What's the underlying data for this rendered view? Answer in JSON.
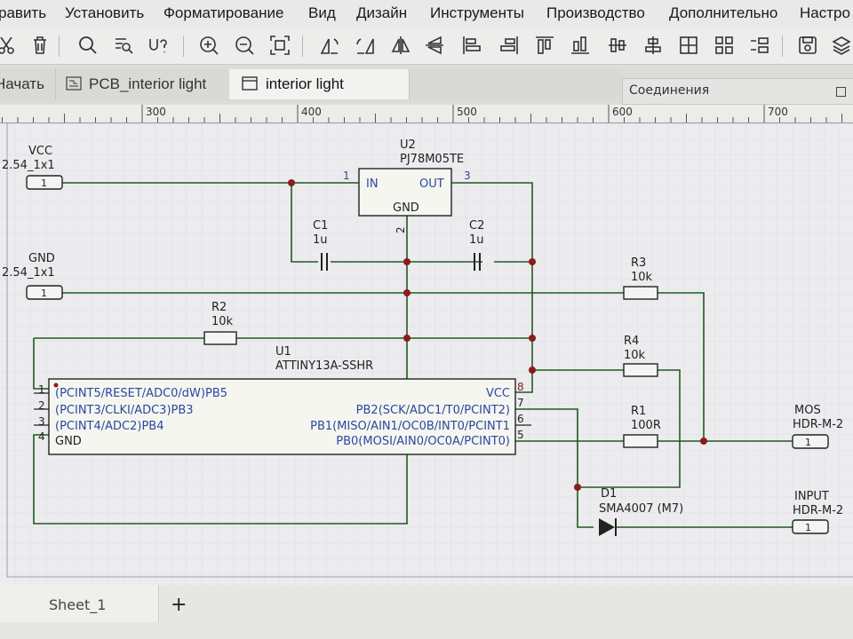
{
  "menu": {
    "items": [
      "равить",
      "Установить",
      "Форматирование",
      "Вид",
      "Дизайн",
      "Инструменты",
      "Производство",
      "Дополнительно",
      "Настро"
    ]
  },
  "tabs": [
    {
      "label": "Начать",
      "icon": "none"
    },
    {
      "label": "PCB_interior light",
      "icon": "pcb-icon"
    },
    {
      "label": "interior light",
      "icon": "schematic-icon",
      "active": true
    }
  ],
  "panel": {
    "title": "Соединения"
  },
  "ruler": {
    "labels": [
      "300",
      "400",
      "500",
      "600",
      "700"
    ]
  },
  "sheets": {
    "tabs": [
      "Sheet_1"
    ],
    "add_label": "+"
  },
  "colors": {
    "wire": "#1e5a1e",
    "junction": "#8a1c1c",
    "pin_number": "#8a1c1c",
    "pin_name": "#2848a0",
    "grid": "#c9ccd6",
    "canvas": "#ecebee"
  },
  "schematic": {
    "connectors": {
      "vcc": {
        "name": "VCC",
        "package": "2.54_1x1",
        "pin": "1"
      },
      "gnd": {
        "name": "GND",
        "package": "2.54_1x1",
        "pin": "1"
      },
      "mos": {
        "name": "MOS",
        "package": "HDR-M-2",
        "pin": "1"
      },
      "input": {
        "name": "INPUT",
        "package": "HDR-M-2",
        "pin": "1"
      }
    },
    "u2": {
      "ref": "U2",
      "value": "PJ78M05TE",
      "pin_in_name": "IN",
      "pin_out_name": "OUT",
      "pin_gnd_name": "GND",
      "pin_in_num": "1",
      "pin_out_num": "3",
      "pin_gnd_num": "2"
    },
    "c1": {
      "ref": "C1",
      "value": "1u"
    },
    "c2": {
      "ref": "C2",
      "value": "1u"
    },
    "r1": {
      "ref": "R1",
      "value": "100R"
    },
    "r2": {
      "ref": "R2",
      "value": "10k"
    },
    "r3": {
      "ref": "R3",
      "value": "10k"
    },
    "r4": {
      "ref": "R4",
      "value": "10k"
    },
    "d1": {
      "ref": "D1",
      "value": "SMA4007 (M7)"
    },
    "u1": {
      "ref": "U1",
      "value": "ATTINY13A-SSHR",
      "left_pins": [
        {
          "num": "1",
          "name": "(PCINT5/RESET/ADC0/dW)PB5"
        },
        {
          "num": "2",
          "name": "(PCINT3/CLKI/ADC3)PB3"
        },
        {
          "num": "3",
          "name": "(PCINT4/ADC2)PB4"
        },
        {
          "num": "4",
          "name": "GND"
        }
      ],
      "right_pins": [
        {
          "num": "8",
          "name": "VCC"
        },
        {
          "num": "7",
          "name": "PB2(SCK/ADC1/T0/PCINT2)"
        },
        {
          "num": "6",
          "name": "PB1(MISO/AIN1/OC0B/INT0/PCINT1"
        },
        {
          "num": "5",
          "name": "PB0(MOSI/AIN0/OC0A/PCINT0)"
        }
      ]
    }
  }
}
